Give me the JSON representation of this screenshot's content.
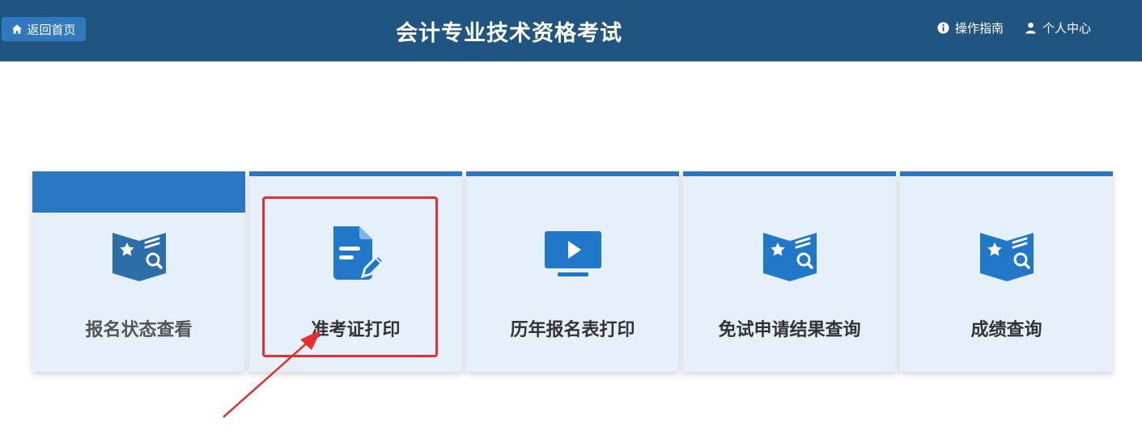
{
  "header": {
    "home_label": "返回首页",
    "title": "会计专业技术资格考试",
    "guide_label": "操作指南",
    "user_center_label": "个人中心"
  },
  "cards": [
    {
      "label": "报名状态查看",
      "icon": "star-book-search-icon"
    },
    {
      "label": "准考证打印",
      "icon": "document-edit-icon"
    },
    {
      "label": "历年报名表打印",
      "icon": "video-play-icon"
    },
    {
      "label": "免试申请结果查询",
      "icon": "star-book-search-icon"
    },
    {
      "label": "成绩查询",
      "icon": "star-book-search-icon"
    }
  ],
  "colors": {
    "header_bg": "#215581",
    "accent": "#2c77c3",
    "card_bg": "#e5f0fb",
    "annotation": "#e4312f"
  }
}
